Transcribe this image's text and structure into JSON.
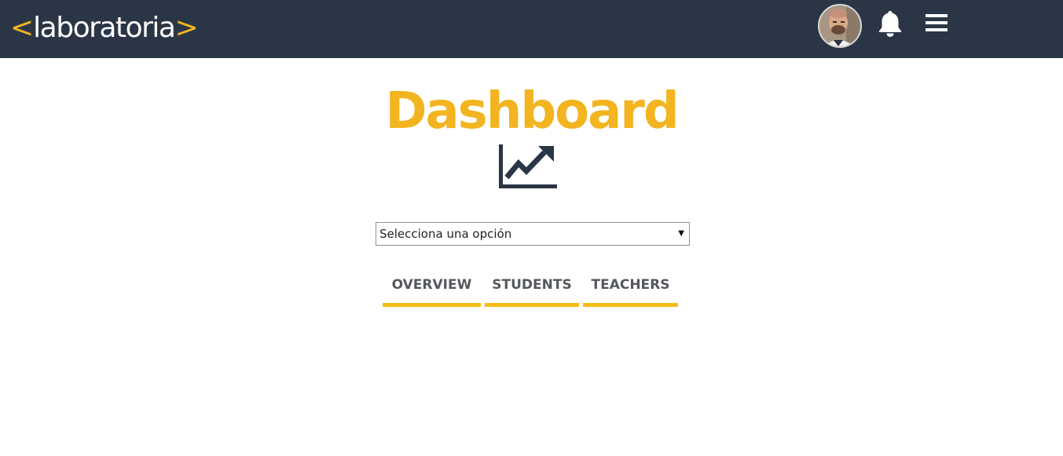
{
  "header": {
    "logo": {
      "open_bracket": "<",
      "word": "laboratoria",
      "close_bracket": ">"
    },
    "avatar_icon": "user-avatar",
    "notifications_icon": "bell-icon",
    "menu_icon": "hamburger-menu-icon"
  },
  "main": {
    "title": "Dashboard",
    "title_icon": "line-chart-icon",
    "select": {
      "value": "Selecciona una opción",
      "caret": "▼"
    },
    "tabs": [
      {
        "label": "OVERVIEW"
      },
      {
        "label": "STUDENTS"
      },
      {
        "label": "TEACHERS"
      }
    ]
  },
  "colors": {
    "topbar": "#2a3646",
    "accent": "#f2b41f",
    "tab_underline": "#f7bd16",
    "tab_text": "#55585c",
    "icon_dark": "#2a3646"
  }
}
